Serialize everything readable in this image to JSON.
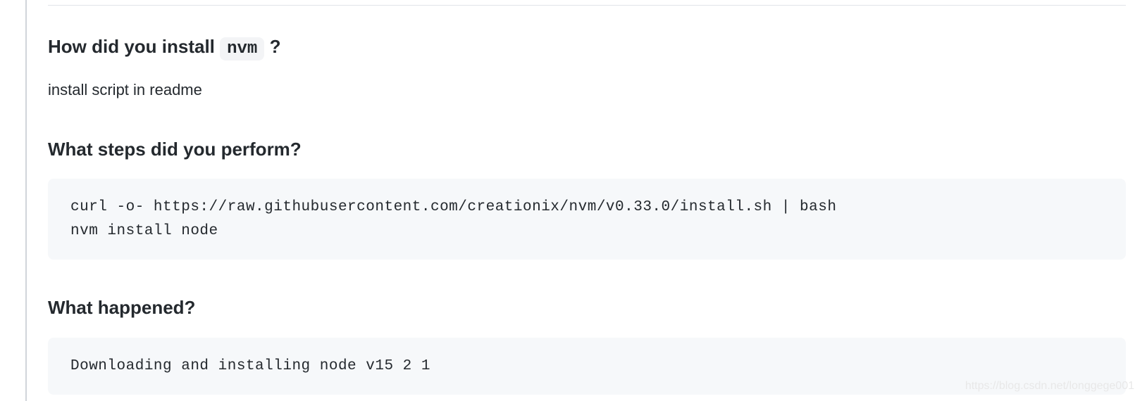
{
  "sections": {
    "install": {
      "heading_prefix": "How did you install ",
      "heading_code": "nvm",
      "heading_suffix": " ?",
      "body": "install script in readme"
    },
    "steps": {
      "heading": "What steps did you perform?",
      "code": "curl -o- https://raw.githubusercontent.com/creationix/nvm/v0.33.0/install.sh | bash\nnvm install node"
    },
    "happened": {
      "heading": "What happened?",
      "code": "Downloading and installing node v15 2 1"
    }
  },
  "watermark": "https://blog.csdn.net/longgege001"
}
